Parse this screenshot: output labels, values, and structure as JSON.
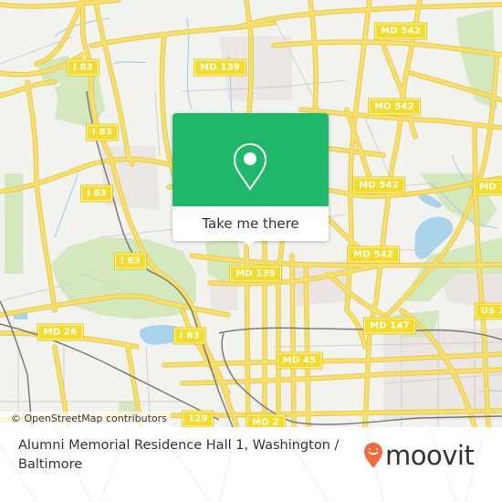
{
  "map": {
    "attribution": "© OpenStreetMap contributors",
    "colors": {
      "background": "#f2f2ef",
      "road": "#f7e06a",
      "road_outline": "#e8cc4a",
      "park": "#d6e9c0",
      "water": "#a9d3ea",
      "rail": "#777777",
      "urban": "#e8e2e0",
      "minor_road": "#cfcfcf"
    },
    "shields": [
      {
        "label": "MD 542",
        "id": "md542-a"
      },
      {
        "label": "MD 139",
        "id": "md139-a"
      },
      {
        "label": "MD 542",
        "id": "md542-b"
      },
      {
        "label": "I 83",
        "id": "i83-a"
      },
      {
        "label": "I 83",
        "id": "i83-b"
      },
      {
        "label": "MD 542",
        "id": "md542-c"
      },
      {
        "label": "MD 1",
        "id": "md1"
      },
      {
        "label": "I 83",
        "id": "i83-c"
      },
      {
        "label": "MD 542",
        "id": "md542-d"
      },
      {
        "label": "I 83",
        "id": "i83-d"
      },
      {
        "label": "MD 139",
        "id": "md139-b"
      },
      {
        "label": "US 1",
        "id": "us1"
      },
      {
        "label": "MD 26",
        "id": "md26"
      },
      {
        "label": "MD 147",
        "id": "md147"
      },
      {
        "label": "I 83",
        "id": "i83-e"
      },
      {
        "label": "MD 45",
        "id": "md45"
      },
      {
        "label": "129",
        "id": "r129"
      },
      {
        "label": "MD 2",
        "id": "md2"
      }
    ]
  },
  "popup": {
    "icon": "map-pin-icon",
    "button_label": "Take me there",
    "accent_color": "#1fb86a"
  },
  "footer": {
    "location_title": "Alumni Memorial Residence Hall 1, Washington / Baltimore",
    "brand": "moovit",
    "brand_color": "#f26b3a"
  }
}
